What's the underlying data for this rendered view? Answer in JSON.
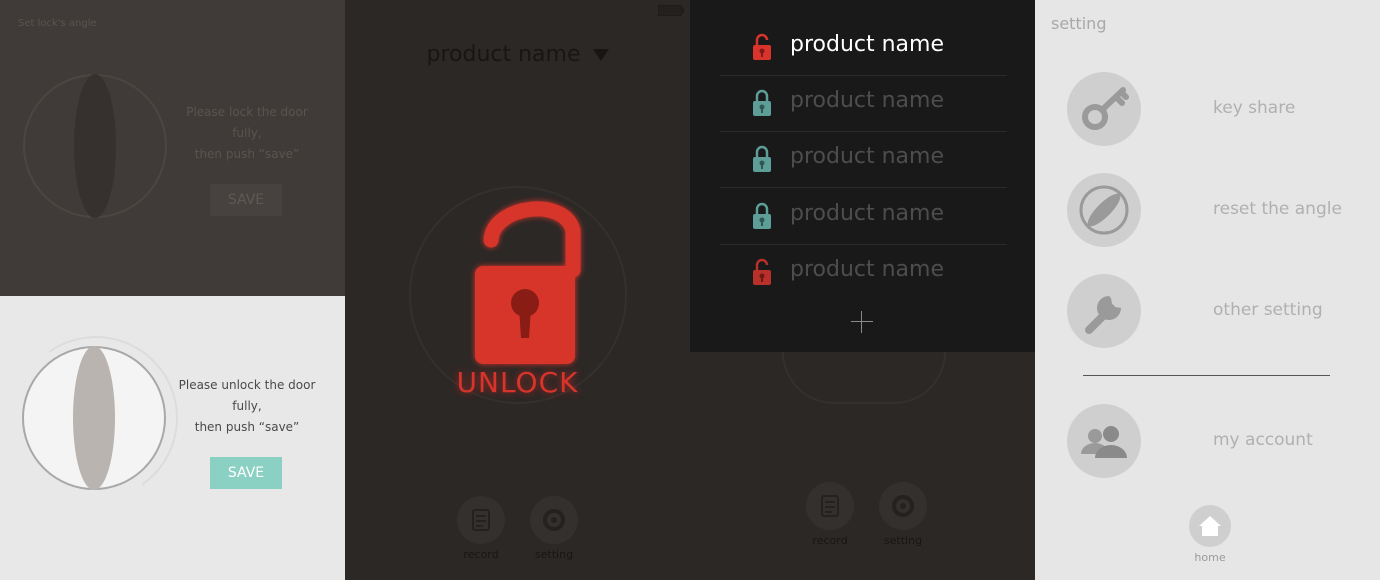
{
  "angle_setup": {
    "title": "Set lock's angle",
    "lock_prompt_line1": "Please lock the door fully,",
    "lock_prompt_line2": "then push “save”",
    "unlock_prompt_line1": "Please unlock the door fully,",
    "unlock_prompt_line2": "then push “save”",
    "save_label": "SAVE"
  },
  "unlock_screen": {
    "product_name": "product name",
    "unlock_label": "UNLOCK",
    "record_label": "record",
    "setting_label": "setting"
  },
  "product_list": {
    "items": [
      {
        "name": "product name",
        "status": "unlocked",
        "active": true
      },
      {
        "name": "product name",
        "status": "locked",
        "active": false
      },
      {
        "name": "product name",
        "status": "locked",
        "active": false
      },
      {
        "name": "product name",
        "status": "locked",
        "active": false
      },
      {
        "name": "product name",
        "status": "unlocked",
        "active": false
      }
    ],
    "record_label": "record",
    "setting_label": "setting"
  },
  "settings": {
    "title": "setting",
    "items": [
      {
        "label": "key share",
        "icon": "key-icon"
      },
      {
        "label": "reset the angle",
        "icon": "angle-icon"
      },
      {
        "label": "other setting",
        "icon": "wrench-icon"
      },
      {
        "label": "my account",
        "icon": "account-icon"
      }
    ],
    "home_label": "home"
  },
  "colors": {
    "accent_red": "#d8342c",
    "accent_teal": "#8ad1c3",
    "lock_teal": "#5e9e98"
  }
}
